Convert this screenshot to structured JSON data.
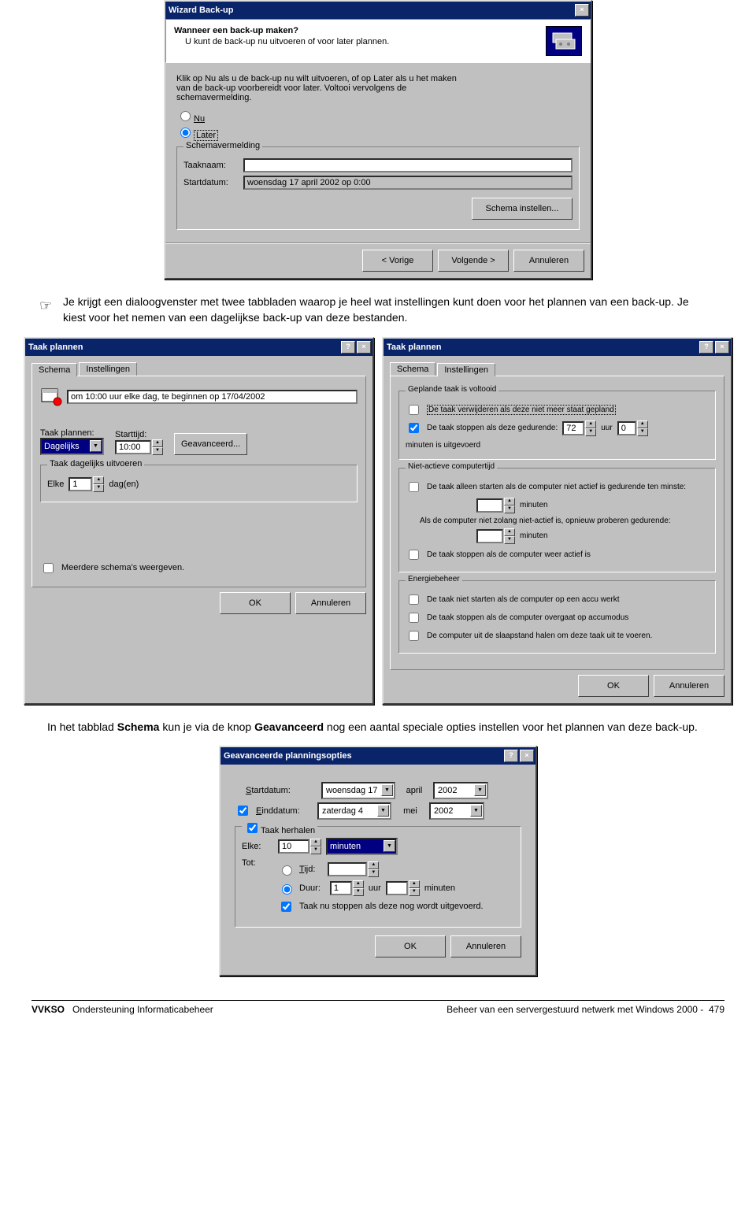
{
  "wizard": {
    "title": "Wizard Back-up",
    "heading": "Wanneer een back-up maken?",
    "subheading": "U kunt de back-up nu uitvoeren of voor later plannen.",
    "instruction": "Klik op Nu als u de back-up nu wilt uitvoeren, of op Later als u het maken van de back-up voorbereidt voor later. Voltooi vervolgens de schemavermelding.",
    "radio_now": "Nu",
    "radio_later": "Later",
    "schedule_group": "Schemavermelding",
    "taskname_label": "Taaknaam:",
    "startdate_label": "Startdatum:",
    "startdate_value": "woensdag 17 april 2002 op 0:00",
    "set_schedule_btn": "Schema instellen...",
    "prev_btn": "< Vorige",
    "next_btn": "Volgende >",
    "cancel_btn": "Annuleren"
  },
  "para1": "Je krijgt een dialoogvenster met twee tabbladen waarop je heel wat instellingen kunt doen voor het plannen van een back-up. Je kiest voor het nemen van een dagelijkse back-up van deze bestanden.",
  "schema_dlg": {
    "title": "Taak plannen",
    "tab_schema": "Schema",
    "tab_settings": "Instellingen",
    "summary": "om 10:00 uur elke dag, te beginnen op 17/04/2002",
    "plan_label": "Taak plannen:",
    "plan_value": "Dagelijks",
    "start_label": "Starttijd:",
    "start_value": "10:00",
    "advanced_btn": "Geavanceerd...",
    "daily_group": "Taak dagelijks uitvoeren",
    "every_label": "Elke",
    "every_value": "1",
    "days_label": "dag(en)",
    "multiple_chk": "Meerdere schema's weergeven.",
    "ok_btn": "OK",
    "cancel_btn": "Annuleren"
  },
  "settings_dlg": {
    "title": "Taak plannen",
    "tab_schema": "Schema",
    "tab_settings": "Instellingen",
    "group_done": "Geplande taak is voltooid",
    "chk_delete": "De taak verwijderen als deze niet meer staat gepland",
    "chk_stop": "De taak stoppen als deze gedurende:",
    "hours_value": "72",
    "hours_label": "uur",
    "min1_value": "0",
    "min1_label": "minuten is uitgevoerd",
    "group_idle": "Niet-actieve computertijd",
    "chk_idle_start": "De taak alleen starten als de computer niet actief is gedurende ten minste:",
    "idle_min_label": "minuten",
    "idle_retry_text": "Als de computer niet zolang niet-actief is, opnieuw proberen gedurende:",
    "idle_retry_min": "minuten",
    "chk_idle_stop": "De taak stoppen als de computer weer actief is",
    "group_power": "Energiebeheer",
    "chk_power1": "De taak niet starten als de computer op een accu werkt",
    "chk_power2": "De taak stoppen als de computer overgaat op accumodus",
    "chk_power3": "De computer uit de slaapstand halen om deze taak uit te voeren.",
    "ok_btn": "OK",
    "cancel_btn": "Annuleren"
  },
  "para2_a": "In het tabblad ",
  "para2_b": "Schema",
  "para2_c": " kun je via de knop ",
  "para2_d": "Geavanceerd",
  "para2_e": " nog een aantal speciale opties instellen voor het plannen van deze back-up.",
  "adv_dlg": {
    "title": "Geavanceerde planningsopties",
    "startdate_label": "Startdatum:",
    "startdate_val": "woensdag 17",
    "startdate_month": "april",
    "startdate_year": "2002",
    "enddate_chk": "Einddatum:",
    "enddate_val": "zaterdag    4",
    "enddate_month": "mei",
    "enddate_year": "2002",
    "repeat_group": "Taak herhalen",
    "every_label": "Elke:",
    "every_value": "10",
    "every_unit": "minuten",
    "until_label": "Tot:",
    "radio_time": "Tijd:",
    "radio_duration": "Duur:",
    "dur_h": "1",
    "dur_h_label": "uur",
    "dur_m_label": "minuten",
    "chk_stop_running": "Taak nu stoppen als deze nog wordt uitgevoerd.",
    "ok_btn": "OK",
    "cancel_btn": "Annuleren"
  },
  "footer": {
    "org": "VVKSO",
    "left": "Ondersteuning Informaticabeheer",
    "right": "Beheer van een servergestuurd netwerk met Windows 2000 -",
    "page": "479"
  }
}
